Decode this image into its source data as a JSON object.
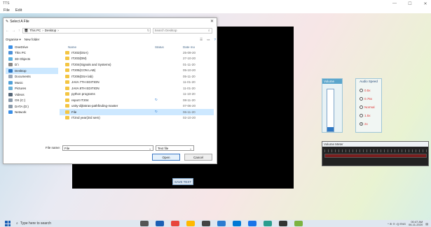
{
  "app": {
    "title": "TTS",
    "menu": [
      "File",
      "Edit"
    ],
    "controls": [
      "—",
      "☐",
      "✕"
    ]
  },
  "save_text": "SAVE TEXT",
  "volume": {
    "title": "Volume",
    "level": 0.1
  },
  "audio_speed": {
    "title": "Audio Speed",
    "options": [
      {
        "label": "0.5x",
        "selected": false
      },
      {
        "label": "0.75x",
        "selected": false
      },
      {
        "label": "Normal",
        "selected": false
      },
      {
        "label": "1.5x",
        "selected": false
      },
      {
        "label": "2x",
        "selected": true
      }
    ]
  },
  "volume_meter": {
    "title": "Volume Meter"
  },
  "dialog": {
    "title": "Select A File",
    "breadcrumb": [
      "This PC",
      "Desktop"
    ],
    "search_placeholder": "Search Desktop",
    "toolbar": {
      "organise": "Organise ▾",
      "new_folder": "New folder"
    },
    "sidebar": [
      {
        "label": "OneDrive",
        "color": "#3a8ee6"
      },
      {
        "label": "This PC",
        "color": "#4a90d9"
      },
      {
        "label": "3D Objects",
        "color": "#5ab0e0"
      },
      {
        "label": "D:\\",
        "color": "#888888"
      },
      {
        "label": "Desktop",
        "color": "#2f78c4",
        "selected": true
      },
      {
        "label": "Documents",
        "color": "#9aa7b8"
      },
      {
        "label": "Music",
        "color": "#4fa0d8"
      },
      {
        "label": "Pictures",
        "color": "#6ab0d8"
      },
      {
        "label": "Videos",
        "color": "#556677"
      },
      {
        "label": "OS (C:)",
        "color": "#8899aa"
      },
      {
        "label": "DATA (D:)",
        "color": "#8899aa"
      },
      {
        "label": "Network",
        "color": "#3a8ee6"
      }
    ],
    "columns": {
      "name": "Name",
      "status": "Status",
      "date": "Date mo"
    },
    "files": [
      {
        "name": "IT202(DSA)",
        "status": "",
        "date": "25-09-20"
      },
      {
        "name": "IT203(DM)",
        "status": "",
        "date": "27-10-20"
      },
      {
        "name": "IT204(Signals and Systems)",
        "status": "",
        "date": "01-11-20"
      },
      {
        "name": "IT205(CON LAB)",
        "status": "",
        "date": "05-10-20"
      },
      {
        "name": "IT206(DSA lab)",
        "status": "",
        "date": "05-11-20"
      },
      {
        "name": "JAVA 7TH EDITION",
        "status": "",
        "date": "11-01-20"
      },
      {
        "name": "JAVA 8TH EDITION",
        "status": "",
        "date": "11-01-20"
      },
      {
        "name": "python programs",
        "status": "",
        "date": "11-10-20"
      },
      {
        "name": "report IT204",
        "status": "↻",
        "date": "08-11-20"
      },
      {
        "name": "unity-dijkstras-pathfinding-master",
        "status": "",
        "date": "07-06-20"
      },
      {
        "name": "File",
        "status": "↻",
        "date": "06-11-20",
        "selected": true
      },
      {
        "name": "IT2nd year(3rd sem)",
        "status": "",
        "date": "02-10-20"
      }
    ],
    "file_name_label": "File name:",
    "file_name_value": "File",
    "file_type": "Text file",
    "open_label": "Open",
    "cancel_label": "Cancel"
  },
  "taskbar": {
    "search_placeholder": "Type here to search",
    "apps": [
      "#555555",
      "#1a5fb4",
      "#e8453c",
      "#ffb900",
      "#444444",
      "#2a7bd0",
      "#0078d4",
      "#1a73e8",
      "#2a9d8f",
      "#333333",
      "#7cb342"
    ],
    "tray_text": "^  ⊛  ⊝  ◁)  ENG",
    "time": "00:47 AM",
    "date": "06-11-2020"
  }
}
